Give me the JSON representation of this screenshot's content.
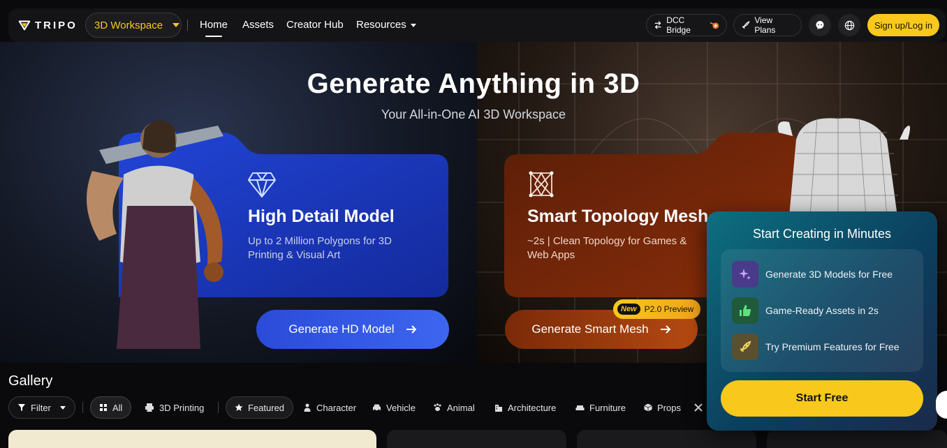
{
  "brand": {
    "name": "TRIPO"
  },
  "nav": {
    "workspace": "3D Workspace",
    "links": [
      "Home",
      "Assets",
      "Creator Hub",
      "Resources"
    ],
    "dcc_bridge": "DCC Bridge",
    "view_plans": "View Plans",
    "signup": "Sign up/Log in"
  },
  "hero": {
    "title": "Generate Anything in 3D",
    "subtitle": "Your All-in-One AI 3D Workspace",
    "hd": {
      "title": "High Detail Model",
      "desc_line1": "Up to 2 Million Polygons for 3D",
      "desc_line2": "Printing & Visual Art",
      "button": "Generate HD Model"
    },
    "smart": {
      "title": "Smart Topology Mesh",
      "desc_line1": "~2s | Clean Topology for Games &",
      "desc_line2": "Web Apps",
      "button": "Generate Smart Mesh",
      "badge_new": "New",
      "badge_text": "P2.0 Preview"
    }
  },
  "gallery": {
    "title": "Gallery",
    "filter": "Filter",
    "chips": [
      "All",
      "3D Printing",
      "Featured",
      "Character",
      "Vehicle",
      "Animal",
      "Architecture",
      "Furniture",
      "Props"
    ]
  },
  "panel": {
    "title": "Start Creating in Minutes",
    "features": [
      "Generate 3D Models for Free",
      "Game-Ready Assets in 2s",
      "Try Premium Features for Free"
    ],
    "cta": "Start Free"
  },
  "colors": {
    "accent": "#f8c91c",
    "hd_blue": "#2a4bd8",
    "smart_orange": "#b54a12",
    "panel_teal": "#0d6f80"
  }
}
